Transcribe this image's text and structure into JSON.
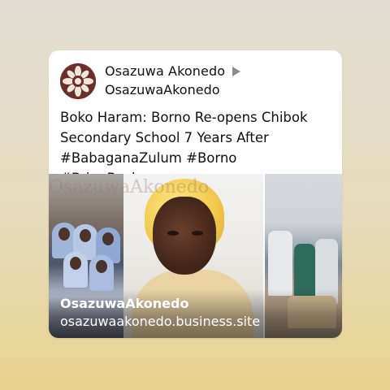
{
  "post": {
    "author_name": "Osazuwa Akonedo",
    "author_handle": "OsazuwaAkonedo",
    "text": "Boko Haram: Borno Re-opens Chibok\nSecondary School 7 Years After\n#BabaganaZulum #Borno #BringBack…"
  },
  "link_preview": {
    "site_name": "OsazuwaAkonedo",
    "url": "osazuwaakonedo.business.site",
    "watermark": "OsazuwaAkonedo"
  },
  "icons": {
    "avatar": "osazuwa-logo-icon",
    "arrow": "play-arrow-icon"
  },
  "colors": {
    "avatar_bg": "#6e2d2a",
    "card_bg": "#ffffff"
  }
}
